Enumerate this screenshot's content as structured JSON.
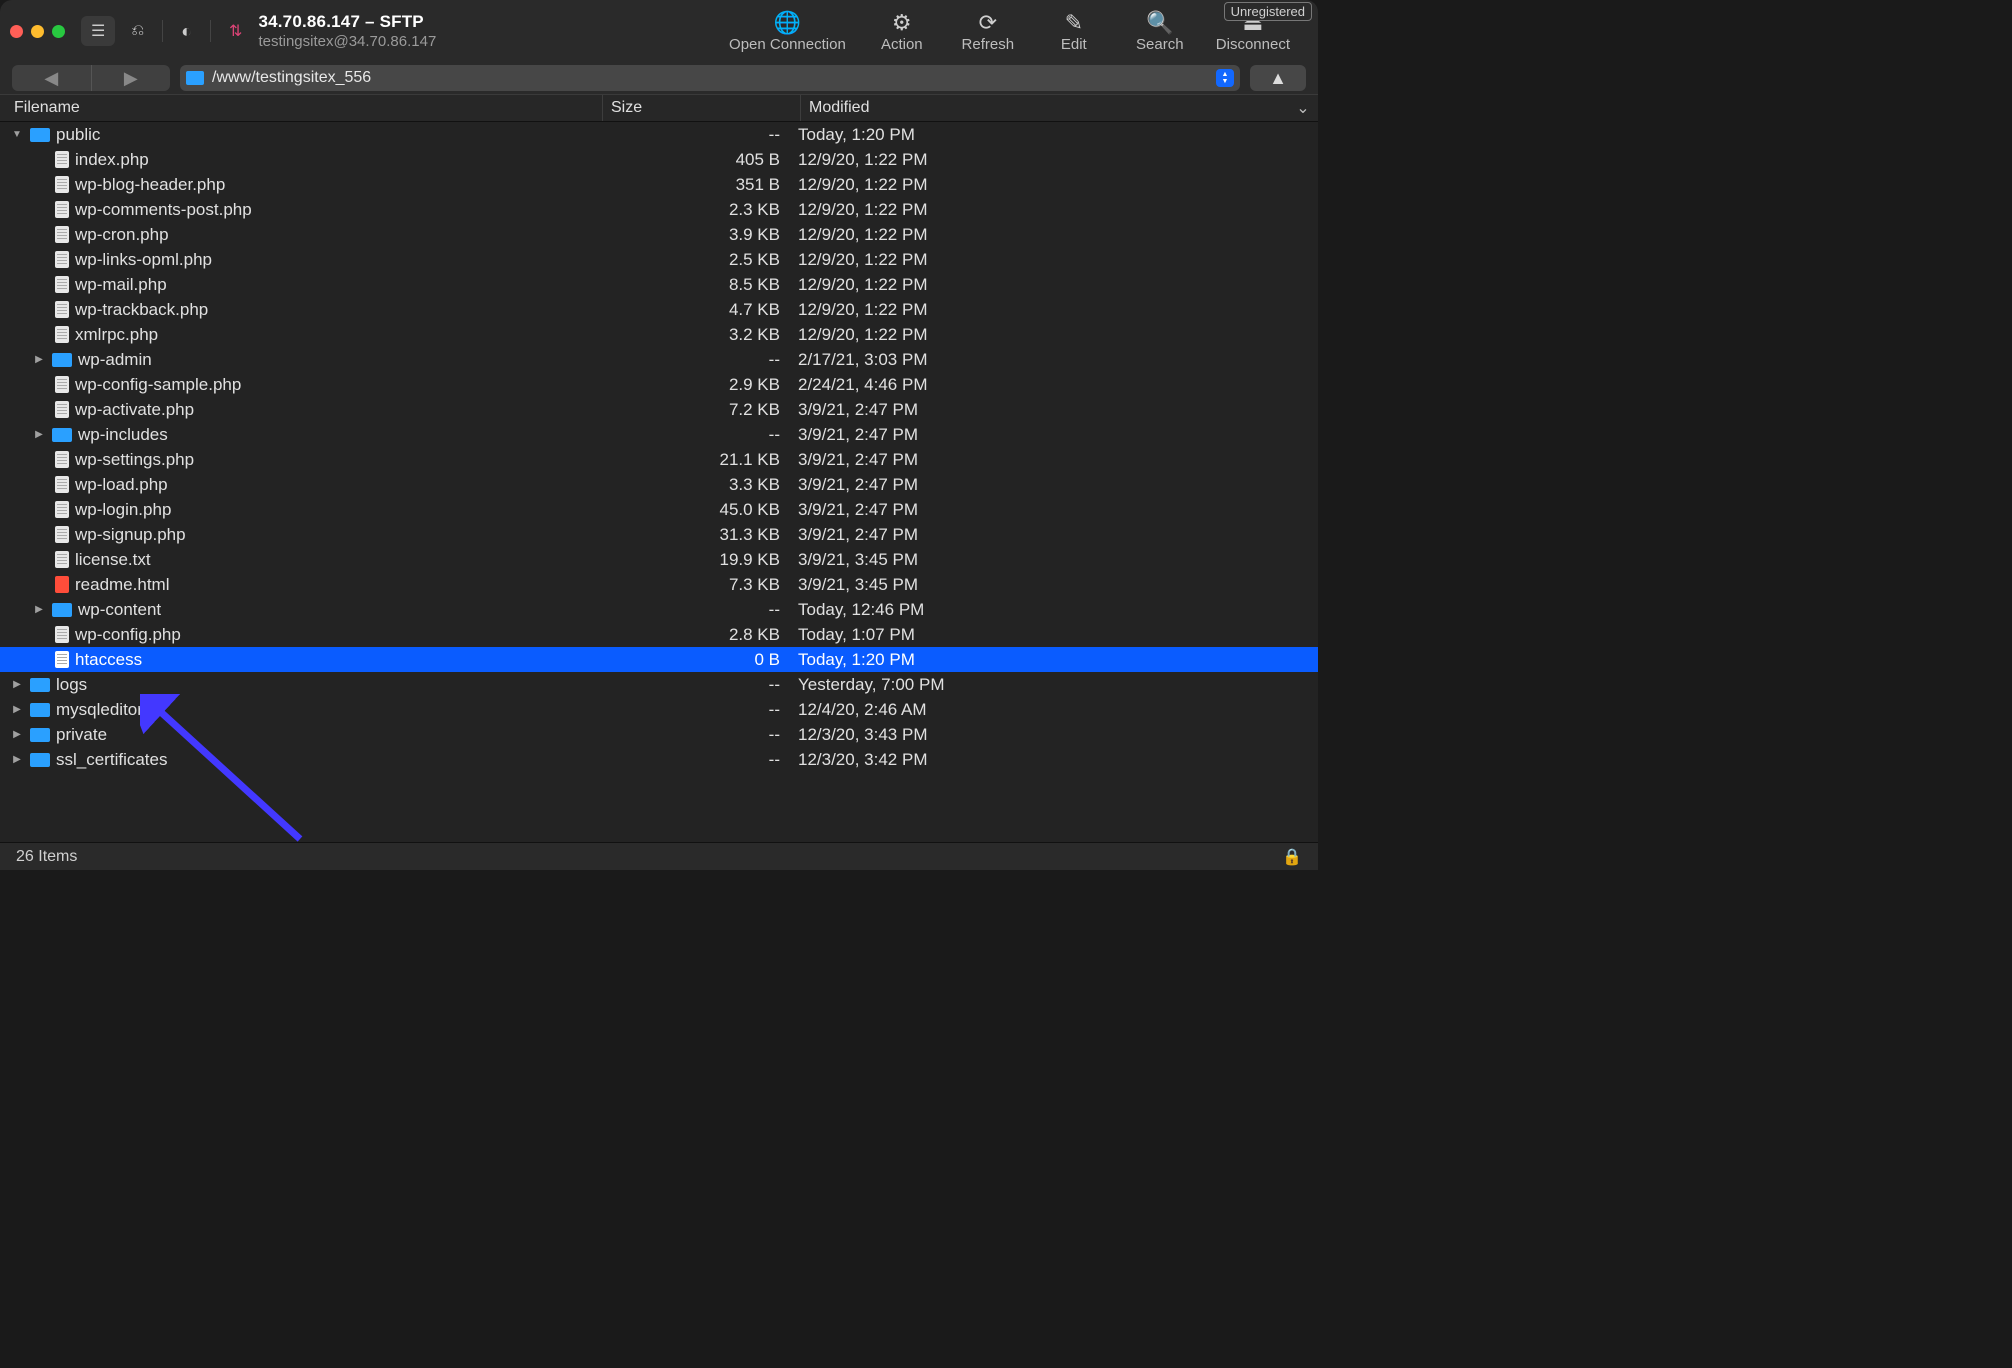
{
  "window": {
    "title": "34.70.86.147 – SFTP",
    "subtitle": "testingsitex@34.70.86.147",
    "unregistered": "Unregistered"
  },
  "toolbar": {
    "open_connection": "Open Connection",
    "action": "Action",
    "refresh": "Refresh",
    "edit": "Edit",
    "search": "Search",
    "disconnect": "Disconnect"
  },
  "path": "/www/testingsitex_556",
  "columns": {
    "filename": "Filename",
    "size": "Size",
    "modified": "Modified"
  },
  "files": [
    {
      "type": "folder",
      "name": "public",
      "size": "--",
      "mod": "Today, 1:20 PM",
      "depth": 0,
      "disc": "down"
    },
    {
      "type": "file",
      "name": "index.php",
      "size": "405 B",
      "mod": "12/9/20, 1:22 PM",
      "depth": 1
    },
    {
      "type": "file",
      "name": "wp-blog-header.php",
      "size": "351 B",
      "mod": "12/9/20, 1:22 PM",
      "depth": 1
    },
    {
      "type": "file",
      "name": "wp-comments-post.php",
      "size": "2.3 KB",
      "mod": "12/9/20, 1:22 PM",
      "depth": 1
    },
    {
      "type": "file",
      "name": "wp-cron.php",
      "size": "3.9 KB",
      "mod": "12/9/20, 1:22 PM",
      "depth": 1
    },
    {
      "type": "file",
      "name": "wp-links-opml.php",
      "size": "2.5 KB",
      "mod": "12/9/20, 1:22 PM",
      "depth": 1
    },
    {
      "type": "file",
      "name": "wp-mail.php",
      "size": "8.5 KB",
      "mod": "12/9/20, 1:22 PM",
      "depth": 1
    },
    {
      "type": "file",
      "name": "wp-trackback.php",
      "size": "4.7 KB",
      "mod": "12/9/20, 1:22 PM",
      "depth": 1
    },
    {
      "type": "file",
      "name": "xmlrpc.php",
      "size": "3.2 KB",
      "mod": "12/9/20, 1:22 PM",
      "depth": 1
    },
    {
      "type": "folder",
      "name": "wp-admin",
      "size": "--",
      "mod": "2/17/21, 3:03 PM",
      "depth": 1,
      "disc": "right"
    },
    {
      "type": "file",
      "name": "wp-config-sample.php",
      "size": "2.9 KB",
      "mod": "2/24/21, 4:46 PM",
      "depth": 1
    },
    {
      "type": "file",
      "name": "wp-activate.php",
      "size": "7.2 KB",
      "mod": "3/9/21, 2:47 PM",
      "depth": 1
    },
    {
      "type": "folder",
      "name": "wp-includes",
      "size": "--",
      "mod": "3/9/21, 2:47 PM",
      "depth": 1,
      "disc": "right"
    },
    {
      "type": "file",
      "name": "wp-settings.php",
      "size": "21.1 KB",
      "mod": "3/9/21, 2:47 PM",
      "depth": 1
    },
    {
      "type": "file",
      "name": "wp-load.php",
      "size": "3.3 KB",
      "mod": "3/9/21, 2:47 PM",
      "depth": 1
    },
    {
      "type": "file",
      "name": "wp-login.php",
      "size": "45.0 KB",
      "mod": "3/9/21, 2:47 PM",
      "depth": 1
    },
    {
      "type": "file",
      "name": "wp-signup.php",
      "size": "31.3 KB",
      "mod": "3/9/21, 2:47 PM",
      "depth": 1
    },
    {
      "type": "file",
      "name": "license.txt",
      "size": "19.9 KB",
      "mod": "3/9/21, 3:45 PM",
      "depth": 1
    },
    {
      "type": "html",
      "name": "readme.html",
      "size": "7.3 KB",
      "mod": "3/9/21, 3:45 PM",
      "depth": 1
    },
    {
      "type": "folder",
      "name": "wp-content",
      "size": "--",
      "mod": "Today, 12:46 PM",
      "depth": 1,
      "disc": "right"
    },
    {
      "type": "file",
      "name": "wp-config.php",
      "size": "2.8 KB",
      "mod": "Today, 1:07 PM",
      "depth": 1
    },
    {
      "type": "file",
      "name": "htaccess",
      "size": "0 B",
      "mod": "Today, 1:20 PM",
      "depth": 1,
      "selected": true
    },
    {
      "type": "folder",
      "name": "logs",
      "size": "--",
      "mod": "Yesterday, 7:00 PM",
      "depth": 0,
      "disc": "right"
    },
    {
      "type": "folder",
      "name": "mysqleditor",
      "size": "--",
      "mod": "12/4/20, 2:46 AM",
      "depth": 0,
      "disc": "right"
    },
    {
      "type": "folder",
      "name": "private",
      "size": "--",
      "mod": "12/3/20, 3:43 PM",
      "depth": 0,
      "disc": "right"
    },
    {
      "type": "folder",
      "name": "ssl_certificates",
      "size": "--",
      "mod": "12/3/20, 3:42 PM",
      "depth": 0,
      "disc": "right"
    }
  ],
  "status": {
    "items": "26 Items"
  }
}
